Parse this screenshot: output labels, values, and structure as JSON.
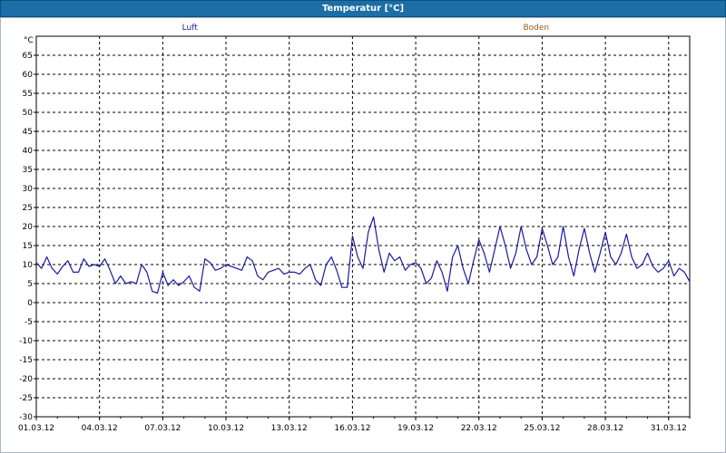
{
  "window": {
    "title": "Temperatur [°C]"
  },
  "chart_data": {
    "type": "line",
    "title": "Temperatur [°C]",
    "ylabel": "°C",
    "ylim": [
      -30,
      70
    ],
    "yticks": [
      65,
      60,
      55,
      50,
      45,
      40,
      35,
      30,
      25,
      20,
      15,
      10,
      5,
      0,
      -5,
      -10,
      -15,
      -20,
      -25,
      -30
    ],
    "xlim": [
      "2012-03-01",
      "2012-04-01"
    ],
    "xtick_labels": [
      "01.03.12",
      "04.03.12",
      "07.03.12",
      "10.03.12",
      "13.03.12",
      "16.03.12",
      "19.03.12",
      "22.03.12",
      "25.03.12",
      "28.03.12",
      "31.03.12"
    ],
    "xtick_dates": [
      "2012-03-01",
      "2012-03-04",
      "2012-03-07",
      "2012-03-10",
      "2012-03-13",
      "2012-03-16",
      "2012-03-19",
      "2012-03-22",
      "2012-03-25",
      "2012-03-28",
      "2012-03-31"
    ],
    "grid": true,
    "legend": [
      {
        "name": "Luft",
        "color": "#1a1aa0"
      },
      {
        "name": "Boden",
        "color": "#a05a14"
      }
    ],
    "series": [
      {
        "name": "Luft",
        "color": "#1a1aa0",
        "points": [
          [
            "2012-03-01 00:00",
            10.5
          ],
          [
            "2012-03-01 06:00",
            9
          ],
          [
            "2012-03-01 12:00",
            12
          ],
          [
            "2012-03-01 18:00",
            9
          ],
          [
            "2012-03-02 00:00",
            7.5
          ],
          [
            "2012-03-02 06:00",
            9.5
          ],
          [
            "2012-03-02 12:00",
            11
          ],
          [
            "2012-03-02 18:00",
            8
          ],
          [
            "2012-03-03 00:00",
            8
          ],
          [
            "2012-03-03 06:00",
            11.5
          ],
          [
            "2012-03-03 12:00",
            9.5
          ],
          [
            "2012-03-03 18:00",
            10
          ],
          [
            "2012-03-04 00:00",
            9.5
          ],
          [
            "2012-03-04 06:00",
            11.5
          ],
          [
            "2012-03-04 12:00",
            8.5
          ],
          [
            "2012-03-04 18:00",
            5
          ],
          [
            "2012-03-05 00:00",
            7
          ],
          [
            "2012-03-05 06:00",
            5
          ],
          [
            "2012-03-05 12:00",
            5.5
          ],
          [
            "2012-03-05 18:00",
            5
          ],
          [
            "2012-03-06 00:00",
            10
          ],
          [
            "2012-03-06 06:00",
            8
          ],
          [
            "2012-03-06 12:00",
            3
          ],
          [
            "2012-03-06 18:00",
            2.5
          ],
          [
            "2012-03-07 00:00",
            8
          ],
          [
            "2012-03-07 06:00",
            4.5
          ],
          [
            "2012-03-07 12:00",
            6
          ],
          [
            "2012-03-07 18:00",
            4.5
          ],
          [
            "2012-03-08 00:00",
            5.5
          ],
          [
            "2012-03-08 06:00",
            7
          ],
          [
            "2012-03-08 12:00",
            4
          ],
          [
            "2012-03-08 18:00",
            3
          ],
          [
            "2012-03-09 00:00",
            11.5
          ],
          [
            "2012-03-09 06:00",
            10.5
          ],
          [
            "2012-03-09 12:00",
            8.5
          ],
          [
            "2012-03-09 18:00",
            9
          ],
          [
            "2012-03-10 00:00",
            10
          ],
          [
            "2012-03-10 06:00",
            9.5
          ],
          [
            "2012-03-10 12:00",
            9
          ],
          [
            "2012-03-10 18:00",
            8.5
          ],
          [
            "2012-03-11 00:00",
            12
          ],
          [
            "2012-03-11 06:00",
            11
          ],
          [
            "2012-03-11 12:00",
            7
          ],
          [
            "2012-03-11 18:00",
            6
          ],
          [
            "2012-03-12 00:00",
            8
          ],
          [
            "2012-03-12 06:00",
            8.5
          ],
          [
            "2012-03-12 12:00",
            9
          ],
          [
            "2012-03-12 18:00",
            7.5
          ],
          [
            "2012-03-13 00:00",
            8
          ],
          [
            "2012-03-13 06:00",
            8
          ],
          [
            "2012-03-13 12:00",
            7.5
          ],
          [
            "2012-03-13 18:00",
            9
          ],
          [
            "2012-03-14 00:00",
            10
          ],
          [
            "2012-03-14 06:00",
            6
          ],
          [
            "2012-03-14 12:00",
            4.5
          ],
          [
            "2012-03-14 18:00",
            10
          ],
          [
            "2012-03-15 00:00",
            12
          ],
          [
            "2012-03-15 06:00",
            8.5
          ],
          [
            "2012-03-15 12:00",
            4
          ],
          [
            "2012-03-15 18:00",
            4
          ],
          [
            "2012-03-16 00:00",
            17.5
          ],
          [
            "2012-03-16 06:00",
            12
          ],
          [
            "2012-03-16 12:00",
            9
          ],
          [
            "2012-03-16 18:00",
            18.5
          ],
          [
            "2012-03-17 00:00",
            22.5
          ],
          [
            "2012-03-17 06:00",
            14
          ],
          [
            "2012-03-17 12:00",
            8
          ],
          [
            "2012-03-17 18:00",
            13
          ],
          [
            "2012-03-18 00:00",
            11
          ],
          [
            "2012-03-18 06:00",
            12
          ],
          [
            "2012-03-18 12:00",
            8.5
          ],
          [
            "2012-03-18 18:00",
            10
          ],
          [
            "2012-03-19 00:00",
            10.5
          ],
          [
            "2012-03-19 06:00",
            9
          ],
          [
            "2012-03-19 12:00",
            5
          ],
          [
            "2012-03-19 18:00",
            6.5
          ],
          [
            "2012-03-20 00:00",
            11
          ],
          [
            "2012-03-20 06:00",
            8
          ],
          [
            "2012-03-20 12:00",
            3
          ],
          [
            "2012-03-20 18:00",
            12
          ],
          [
            "2012-03-21 00:00",
            15
          ],
          [
            "2012-03-21 06:00",
            9
          ],
          [
            "2012-03-21 12:00",
            5
          ],
          [
            "2012-03-21 18:00",
            11
          ],
          [
            "2012-03-22 00:00",
            16.5
          ],
          [
            "2012-03-22 06:00",
            13
          ],
          [
            "2012-03-22 12:00",
            8
          ],
          [
            "2012-03-22 18:00",
            14
          ],
          [
            "2012-03-23 00:00",
            20
          ],
          [
            "2012-03-23 06:00",
            15
          ],
          [
            "2012-03-23 12:00",
            9
          ],
          [
            "2012-03-23 18:00",
            13
          ],
          [
            "2012-03-24 00:00",
            20
          ],
          [
            "2012-03-24 06:00",
            14
          ],
          [
            "2012-03-24 12:00",
            10
          ],
          [
            "2012-03-24 18:00",
            12
          ],
          [
            "2012-03-25 00:00",
            19.5
          ],
          [
            "2012-03-25 06:00",
            15
          ],
          [
            "2012-03-25 12:00",
            10
          ],
          [
            "2012-03-25 18:00",
            12
          ],
          [
            "2012-03-26 00:00",
            20
          ],
          [
            "2012-03-26 06:00",
            12
          ],
          [
            "2012-03-26 12:00",
            7
          ],
          [
            "2012-03-26 18:00",
            14
          ],
          [
            "2012-03-27 00:00",
            19.5
          ],
          [
            "2012-03-27 06:00",
            13
          ],
          [
            "2012-03-27 12:00",
            8
          ],
          [
            "2012-03-27 18:00",
            13
          ],
          [
            "2012-03-28 00:00",
            18.5
          ],
          [
            "2012-03-28 06:00",
            12
          ],
          [
            "2012-03-28 12:00",
            10
          ],
          [
            "2012-03-28 18:00",
            13
          ],
          [
            "2012-03-29 00:00",
            18
          ],
          [
            "2012-03-29 06:00",
            12
          ],
          [
            "2012-03-29 12:00",
            9
          ],
          [
            "2012-03-29 18:00",
            10
          ],
          [
            "2012-03-30 00:00",
            13
          ],
          [
            "2012-03-30 06:00",
            9.5
          ],
          [
            "2012-03-30 12:00",
            8
          ],
          [
            "2012-03-30 18:00",
            9
          ],
          [
            "2012-03-31 00:00",
            11
          ],
          [
            "2012-03-31 06:00",
            7
          ],
          [
            "2012-03-31 12:00",
            9
          ],
          [
            "2012-03-31 18:00",
            8
          ],
          [
            "2012-04-01 00:00",
            5.5
          ]
        ]
      }
    ]
  }
}
